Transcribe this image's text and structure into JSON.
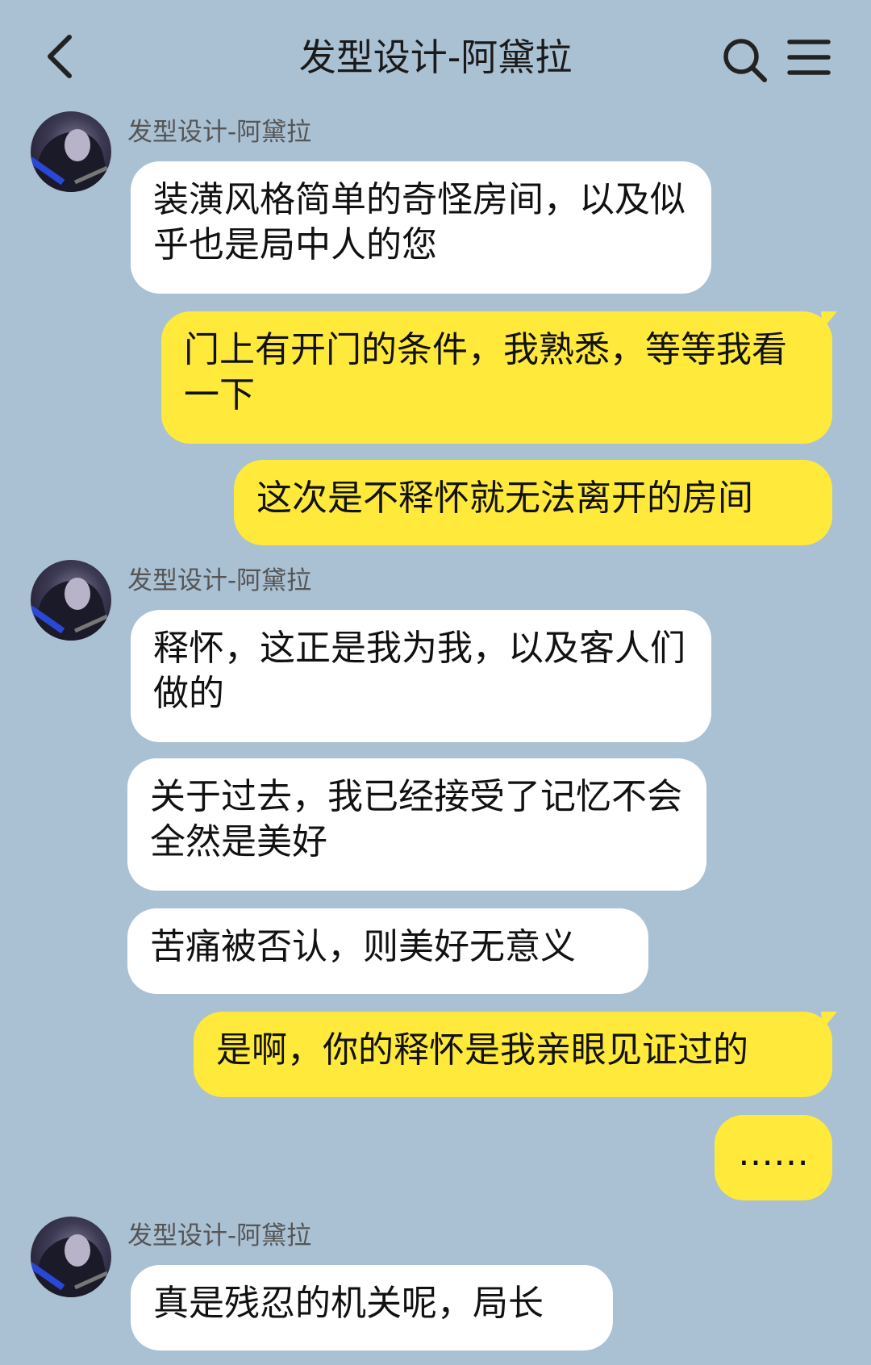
{
  "header": {
    "title": "发型设计-阿黛拉",
    "back_icon": "chevron-left-icon",
    "search_icon": "search-icon",
    "menu_icon": "menu-icon"
  },
  "colors": {
    "background": "#aac0d3",
    "incoming_bubble": "#ffffff",
    "outgoing_bubble": "#ffe93b"
  },
  "messages": [
    {
      "side": "left",
      "sender": "发型设计-阿黛拉",
      "text": "装潢风格简单的奇怪房间，以及似乎也是局中人的您"
    },
    {
      "side": "right",
      "text": "门上有开门的条件，我熟悉，等等我看一下"
    },
    {
      "side": "right",
      "text": "这次是不释怀就无法离开的房间"
    },
    {
      "side": "left",
      "sender": "发型设计-阿黛拉",
      "text": "释怀，这正是我为我，以及客人们做的"
    },
    {
      "side": "left",
      "text": "关于过去，我已经接受了记忆不会全然是美好"
    },
    {
      "side": "left",
      "text": "苦痛被否认，则美好无意义"
    },
    {
      "side": "right",
      "text": "是啊，你的释怀是我亲眼见证过的"
    },
    {
      "side": "right",
      "text": "……"
    },
    {
      "side": "left",
      "sender": "发型设计-阿黛拉",
      "text": "真是残忍的机关呢，局长"
    }
  ]
}
